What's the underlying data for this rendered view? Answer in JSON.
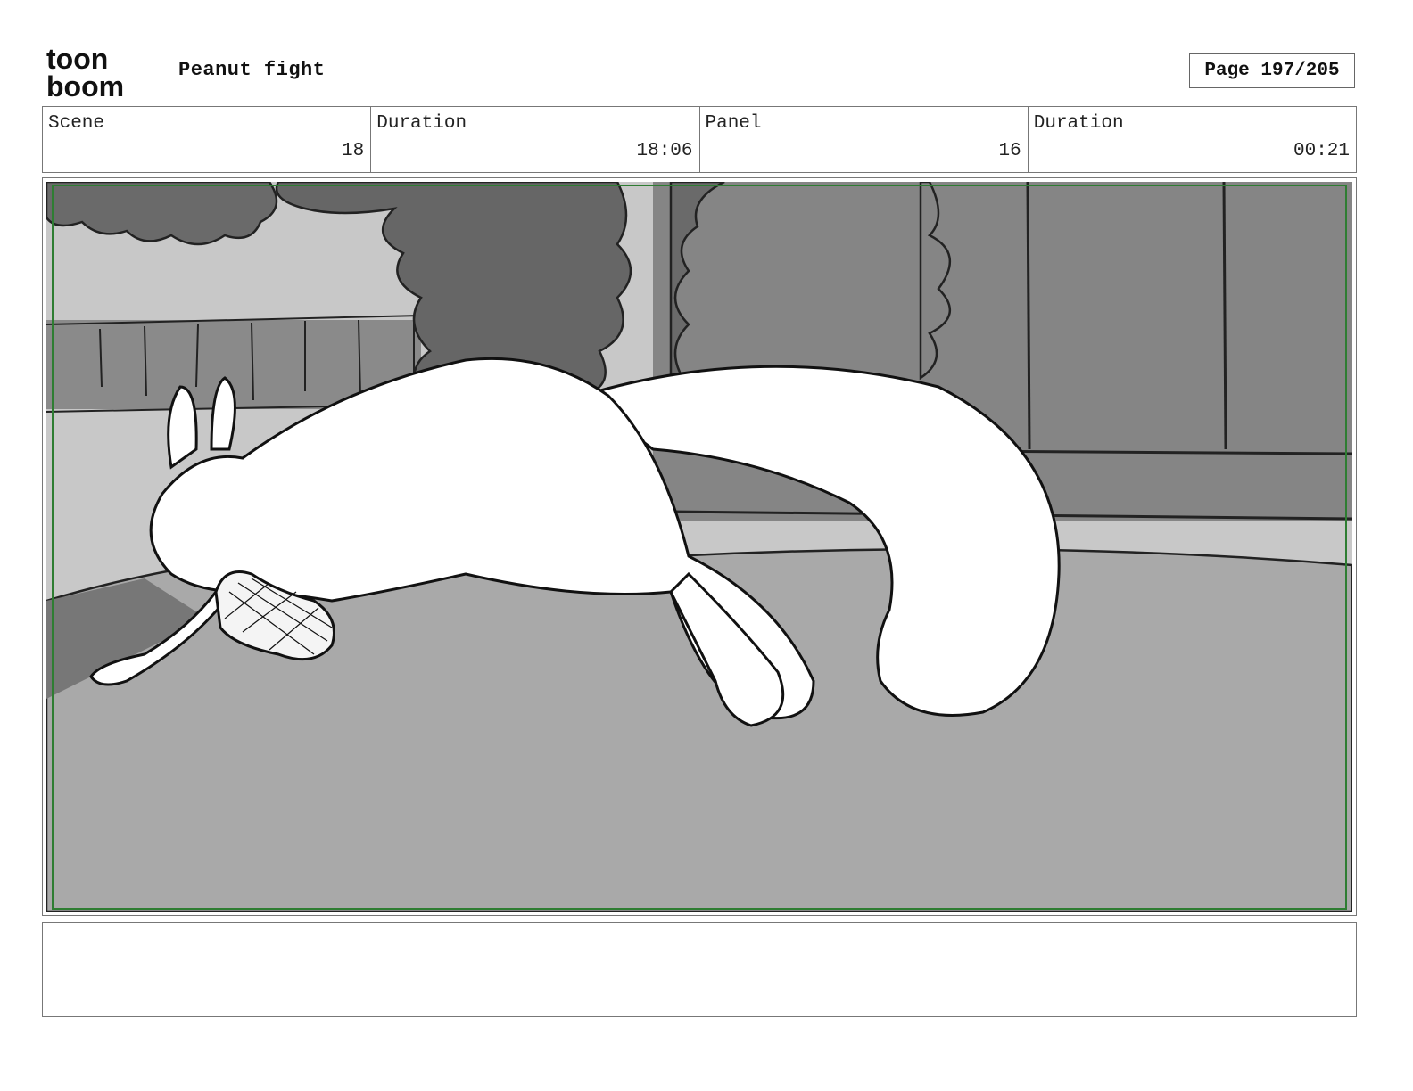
{
  "header": {
    "logo": {
      "line1": "toon",
      "line2": "boom"
    },
    "project_title": "Peanut fight",
    "page_label": "Page 197/205"
  },
  "info": {
    "scene_label": "Scene",
    "scene_value": "18",
    "scene_duration_label": "Duration",
    "scene_duration_value": "18:06",
    "panel_label": "Panel",
    "panel_value": "16",
    "panel_duration_label": "Duration",
    "panel_duration_value": "00:21"
  },
  "colors": {
    "safe_frame": "#2e7d32",
    "sky": "#c8c8c8",
    "bushes": "#6a6a6a",
    "fence": "#858585",
    "ground": "#a9a9a9",
    "character": "#ffffff"
  },
  "notes": {
    "text": ""
  }
}
